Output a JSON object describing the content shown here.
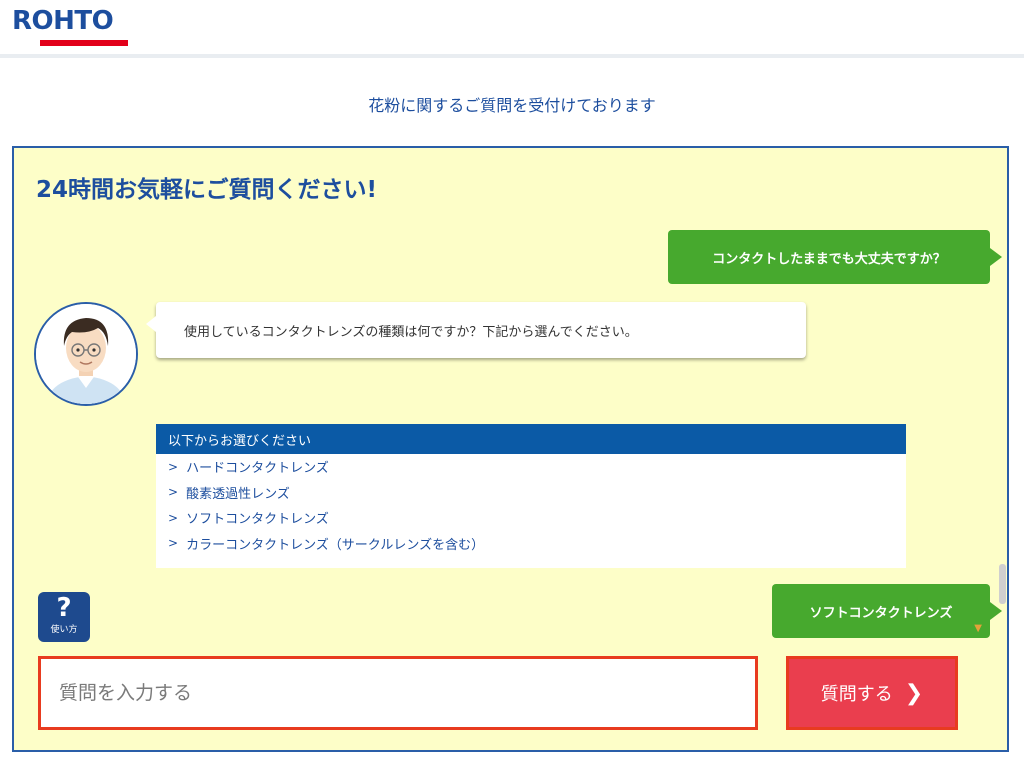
{
  "header": {
    "logo_text": "ROHTO"
  },
  "subtitle": "花粉に関するご質問を受付けております",
  "headline": "24時間お気軽にご質問ください!",
  "chat": {
    "user_message_1": "コンタクトしたままでも大丈夫ですか？",
    "bot_message": "使用しているコンタクトレンズの種類は何ですか？下記から選んでください。",
    "choices_title": "以下からお選びください",
    "choices": [
      "ハードコンタクトレンズ",
      "酸素透過性レンズ",
      "ソフトコンタクトレンズ",
      "カラーコンタクトレンズ（サークルレンズを含む）"
    ],
    "user_message_2": "ソフトコンタクトレンズ"
  },
  "help": {
    "symbol": "?",
    "label": "使い方"
  },
  "input": {
    "placeholder": "質問を入力する"
  },
  "submit": {
    "label": "質問する"
  },
  "colors": {
    "brand_blue": "#1d4e9e",
    "user_bubble": "#47a92e",
    "panel_bg": "#fdfec8",
    "submit_red": "#ea3e4e"
  }
}
